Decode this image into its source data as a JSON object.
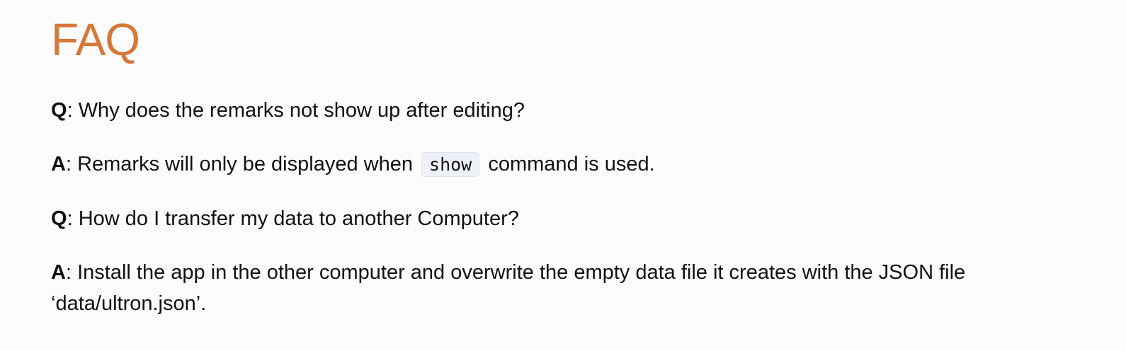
{
  "page": {
    "title": "FAQ"
  },
  "faq": [
    {
      "label": "Q",
      "sep": ": ",
      "text": "Why does the remarks not show up after editing?"
    },
    {
      "label": "A",
      "sep": ": ",
      "text_before": "Remarks will only be displayed when",
      "code": "show",
      "text_after": "command is used."
    },
    {
      "label": "Q",
      "sep": ": ",
      "text": "How do I transfer my data to another Computer?"
    },
    {
      "label": "A",
      "sep": ": ",
      "text": "Install the app in the other computer and overwrite the empty data file it creates with the JSON file ‘data/ultron.json’."
    }
  ],
  "colors": {
    "heading": "#d7773a",
    "code_bg": "#eff1f9",
    "text": "#111111"
  }
}
